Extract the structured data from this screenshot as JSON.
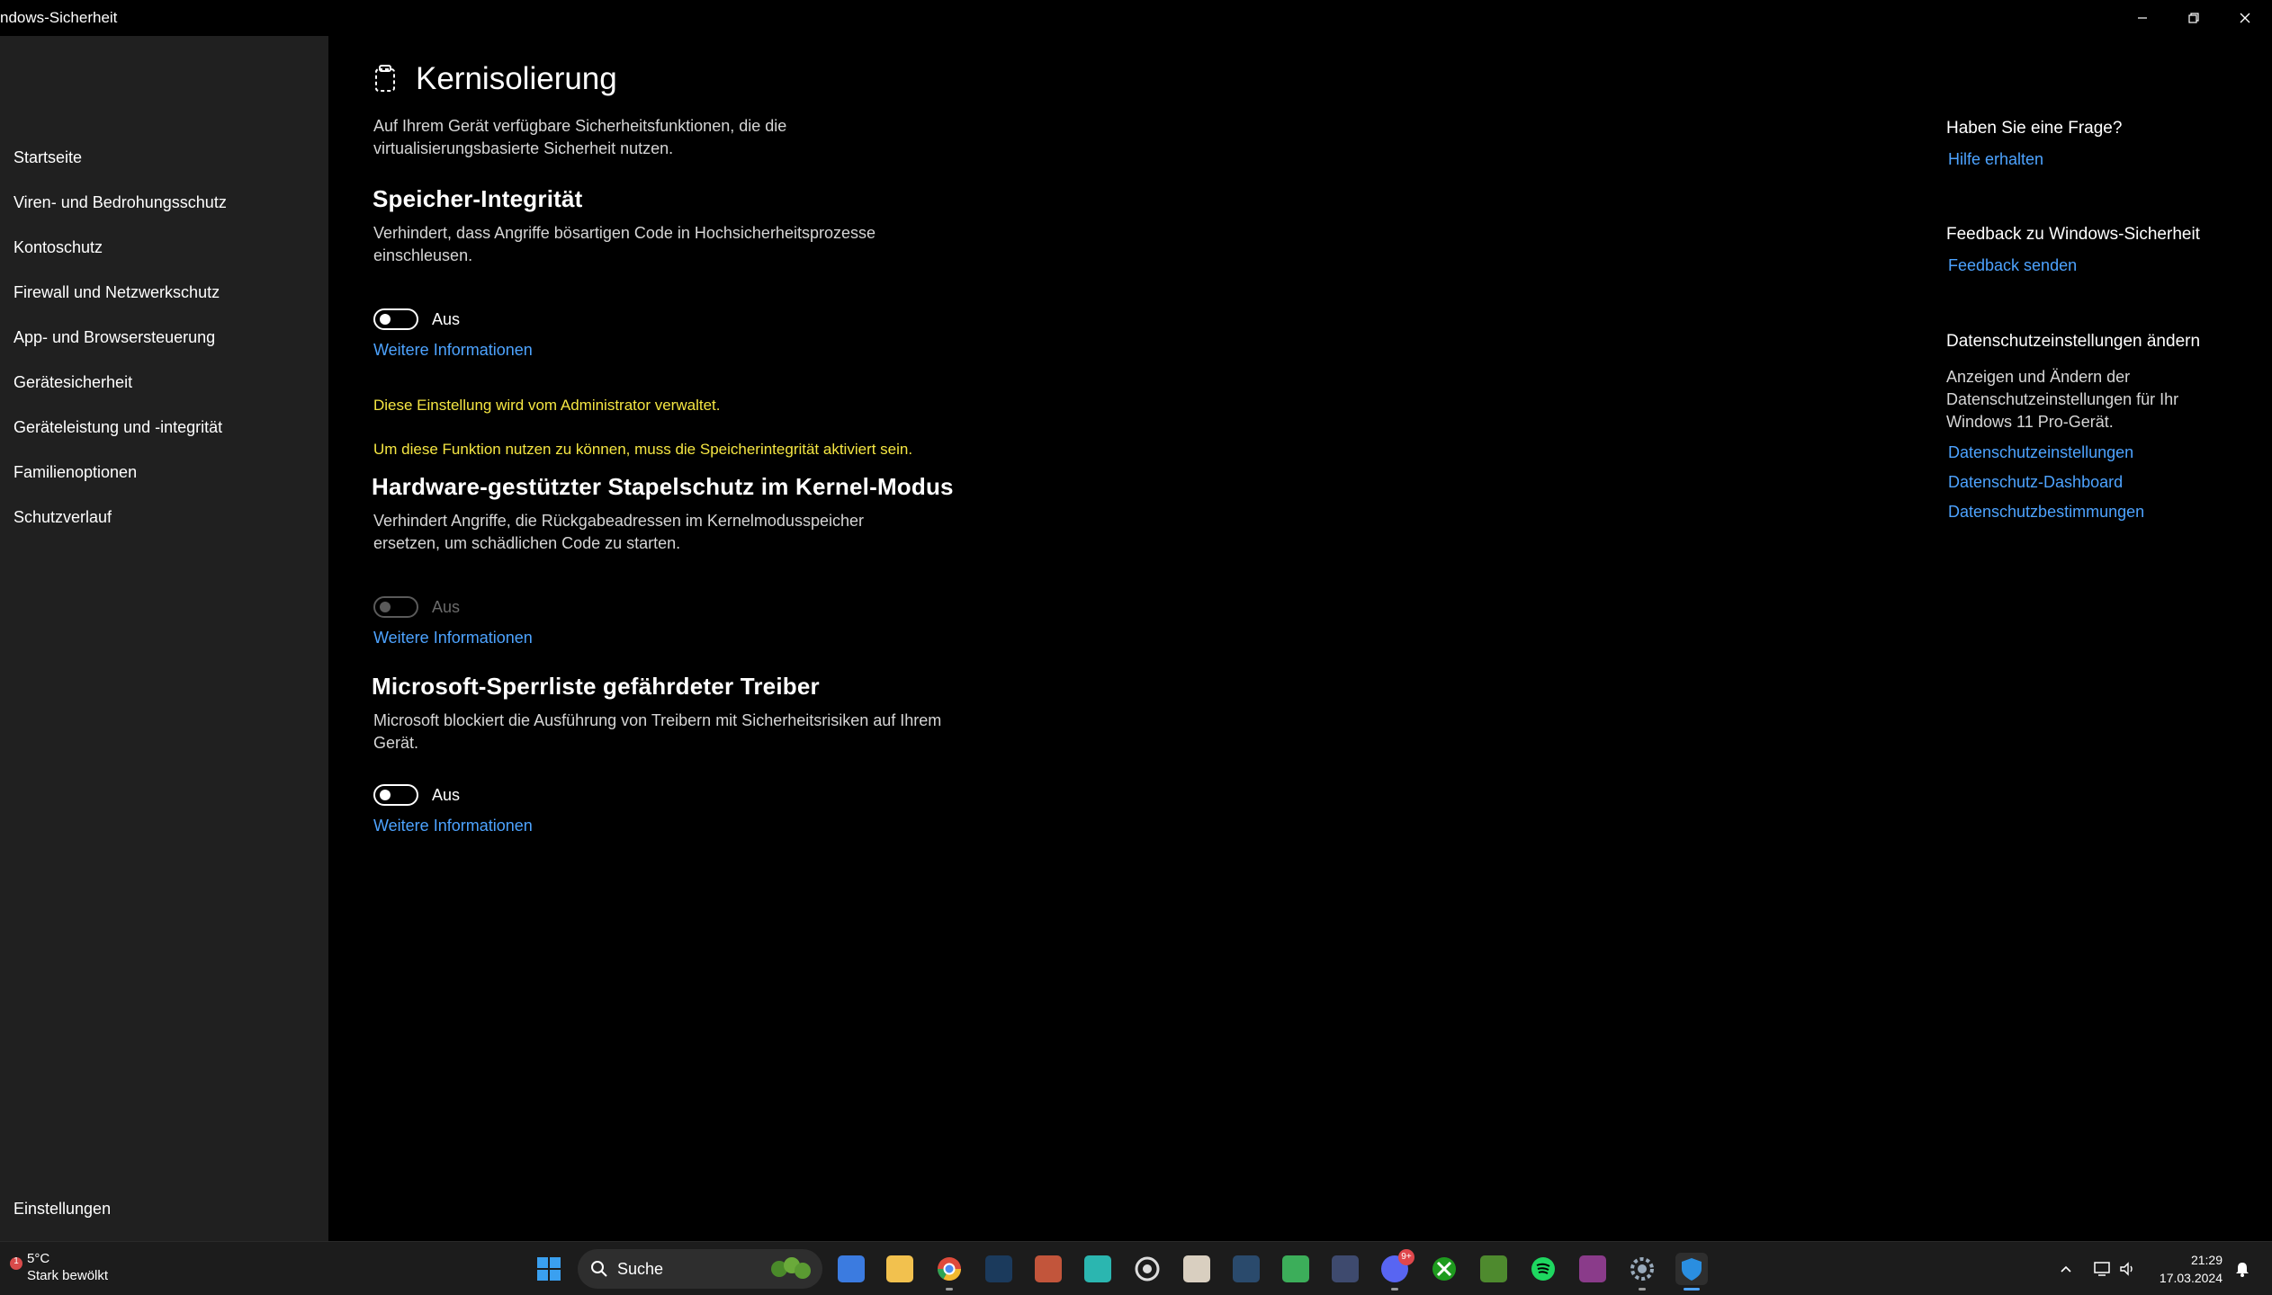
{
  "window": {
    "title": "ndows-Sicherheit"
  },
  "sidebar": {
    "items": [
      {
        "label": "Startseite"
      },
      {
        "label": "Viren- und Bedrohungsschutz"
      },
      {
        "label": "Kontoschutz"
      },
      {
        "label": "Firewall und Netzwerkschutz"
      },
      {
        "label": "App- und Browsersteuerung"
      },
      {
        "label": "Gerätesicherheit"
      },
      {
        "label": "Geräteleistung und -integrität"
      },
      {
        "label": "Familienoptionen"
      },
      {
        "label": "Schutzverlauf"
      }
    ],
    "settings_label": "Einstellungen"
  },
  "main": {
    "title": "Kernisolierung",
    "intro": "Auf Ihrem Gerät verfügbare Sicherheitsfunktionen, die die virtualisierungsbasierte Sicherheit nutzen.",
    "sections": [
      {
        "heading": "Speicher-Integrität",
        "description": "Verhindert, dass Angriffe bösartigen Code in Hochsicherheitsprozesse einschleusen.",
        "toggle_state": "Aus",
        "toggle_on": false,
        "disabled": false,
        "more_link": "Weitere Informationen",
        "admin_note": "Diese Einstellung wird vom Administrator verwaltet."
      },
      {
        "heading": "Hardware-gestützter Stapelschutz im Kernel-Modus",
        "prereq_note": "Um diese Funktion nutzen zu können, muss die Speicherintegrität aktiviert sein.",
        "description": "Verhindert Angriffe, die Rückgabeadressen im Kernelmodusspeicher ersetzen, um schädlichen Code zu starten.",
        "toggle_state": "Aus",
        "toggle_on": false,
        "disabled": true,
        "more_link": "Weitere Informationen"
      },
      {
        "heading": "Microsoft-Sperrliste gefährdeter Treiber",
        "description": "Microsoft blockiert die Ausführung von Treibern mit Sicherheitsrisiken auf Ihrem Gerät.",
        "toggle_state": "Aus",
        "toggle_on": false,
        "disabled": false,
        "more_link": "Weitere Informationen"
      }
    ]
  },
  "right": {
    "question_heading": "Haben Sie eine Frage?",
    "help_link": "Hilfe erhalten",
    "feedback_heading": "Feedback zu Windows-Sicherheit",
    "feedback_link": "Feedback senden",
    "privacy_heading": "Datenschutzeinstellungen ändern",
    "privacy_text": "Anzeigen und Ändern der Datenschutzeinstellungen für Ihr Windows 11 Pro-Gerät.",
    "privacy_links": [
      "Datenschutzeinstellungen",
      "Datenschutz-Dashboard",
      "Datenschutzbestimmungen"
    ]
  },
  "taskbar": {
    "weather_temp": "5°C",
    "weather_desc": "Stark bewölkt",
    "weather_badge": "1",
    "search_label": "Suche",
    "discord_badge": "9+",
    "time": "21:29",
    "date": "17.03.2024",
    "icons": [
      "start-icon",
      "store-icon",
      "file-explorer-icon",
      "chrome-icon",
      "steam-icon",
      "app-icon",
      "bf-icon",
      "app-icon",
      "app-icon",
      "steam-icon",
      "app-icon",
      "app-icon",
      "discord-icon",
      "xbox-icon",
      "minecraft-icon",
      "spotify-icon",
      "winrar-icon",
      "settings-icon",
      "windows-security-icon"
    ],
    "colors": {
      "accent": "#4da3ff",
      "warning": "#f5e642",
      "sidebar_bg": "#202020",
      "taskbar_bg": "#1c1c1c"
    }
  }
}
